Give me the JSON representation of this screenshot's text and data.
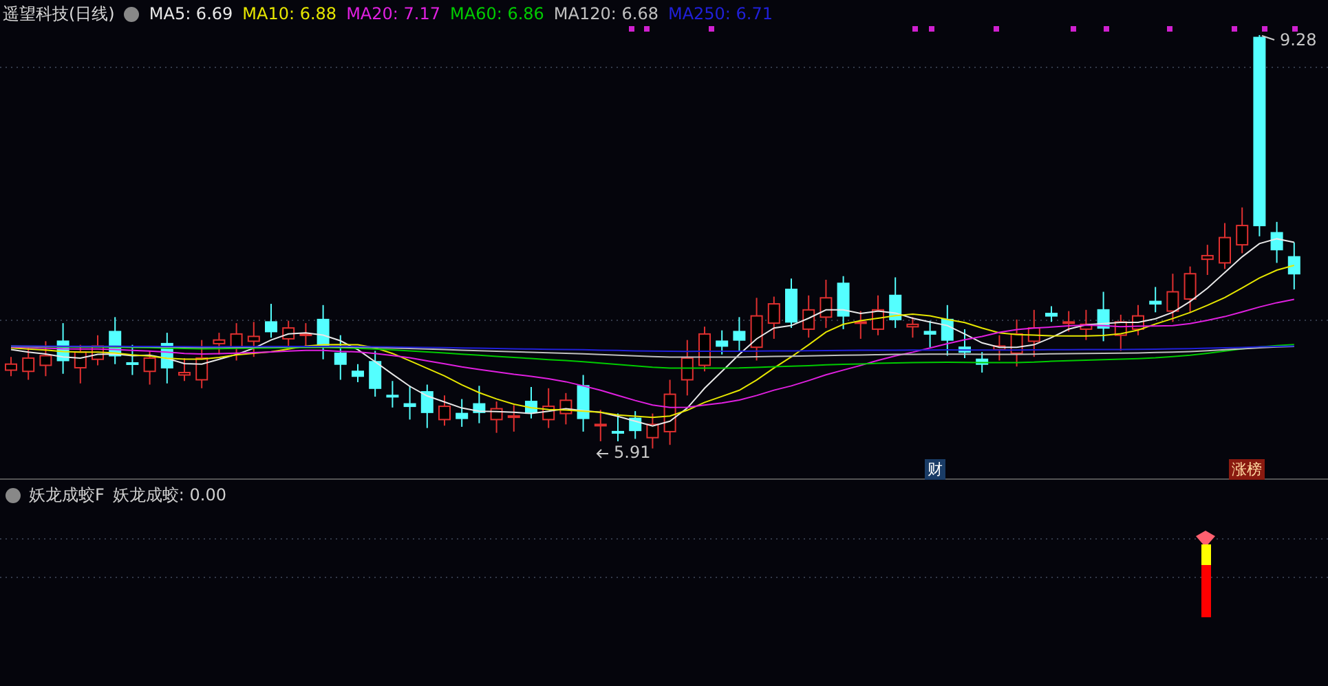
{
  "header": {
    "title": "遥望科技(日线)",
    "indicators": [
      {
        "name": "MA5: 6.69",
        "color": "#e8e8e8"
      },
      {
        "name": "MA10: 6.88",
        "color": "#e6e600"
      },
      {
        "name": "MA20: 7.17",
        "color": "#e020e0"
      },
      {
        "name": "MA60: 6.86",
        "color": "#00cc00"
      },
      {
        "name": "MA120: 6.68",
        "color": "#c0c0c0"
      },
      {
        "name": "MA250: 6.71",
        "color": "#2020d8"
      }
    ]
  },
  "price_labels": {
    "high": "9.28",
    "low": "5.91"
  },
  "event_markers": [
    {
      "label": "财",
      "kind": "finance"
    },
    {
      "label": "涨榜",
      "kind": "rank"
    }
  ],
  "indicator_panel": {
    "name": "妖龙成蛟F",
    "reading": "妖龙成蛟: 0.00"
  }
}
